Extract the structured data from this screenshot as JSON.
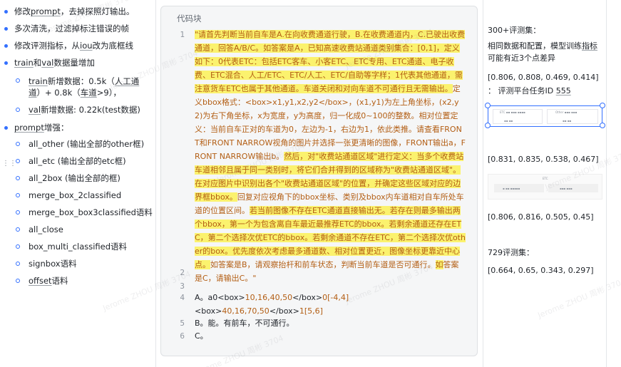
{
  "bullets": [
    {
      "text_a": "修改",
      "text_u": "prompt",
      "text_b": "，去掉探照灯输出。"
    },
    {
      "text": "多次清洗，过滤掉标注错误的帧"
    },
    {
      "text_a": "修改评测指标，从",
      "text_u": "iou",
      "text_b": "改为底框线"
    },
    {
      "text_u": "train",
      "text_a": "和",
      "text_u2": "val",
      "text_b": "数据量增加"
    }
  ],
  "sub_bullets_1": [
    {
      "text_u": "train",
      "text_a": "新增数据：0.5k（",
      "text_u2": "人工通道",
      "text_b": "）+ 0.8k（",
      "text_u3": "车道",
      "text_c": ">9），"
    },
    {
      "text_u": "val",
      "text_a": "新增数据: 0.22k(test数据)"
    }
  ],
  "bullet_prompt": {
    "text_u": "prompt",
    "text_b": "增强："
  },
  "sub_bullets_2": [
    {
      "text": "all_other (输出全部的other框)"
    },
    {
      "text": "all_etc (输出全部的etc框)"
    },
    {
      "text": "all_2box (输出全部的框)"
    },
    {
      "text": "merge_box_2classified"
    },
    {
      "text": "merge_box_box3classified语料"
    },
    {
      "text": "all_close"
    },
    {
      "text": "box_multi_classified语料"
    },
    {
      "text": "signbox语料"
    },
    {
      "text_u": "offset",
      "text_b": "语料"
    }
  ],
  "drag_icon": "⋮⋮",
  "code_block": {
    "title": "代码块",
    "line_numbers": [
      "1",
      "2",
      "3",
      "4",
      "5",
      "6"
    ],
    "line1_parts": [
      {
        "t": "\"请首先判断当前自车是A.在向收费通道行驶，B.在收费通道内，C.已驶出收费通道，回答A/B/C。如答案是A，已知高速收费站通道类别集合：[0,1]，定义如下：0代表ETC：包括ETC客车、小客ETC、ETC专用、ETC通道、电子收费、ETC混合、人工/ETC、ETC/人工、ETC/自助等字样；1代表其他通道，需注意货车ETC也属于其他通道。车道关闭和对向车道不可通行且无需输出。",
        "hl": true
      },
      {
        "t": "定义bbox格式：<box>x1,y1,x2,y2</box>，(x1,y1)为左上角坐标，(x2,y2)为右下角坐标，x为宽度，y为高度，归一化成0~100的整数。相对位置定义：当前自车正对的车道为0，左边为-1，右边为1，依此类推。请查看FRONT和FRONT NARROW视角的图片并选择一张更清晰的图像，FRONT输出a，FRONT NARROW输出b。",
        "hl": false
      },
      {
        "t": "然后，对\"收费站通道区域\"进行定义：当多个收费站车道相邻且属于同一类别时，将它们合并得到的区域称为\"收费站通道区域\"。在对应图片中识别出各个\"收费站通道区域\"的位置，并确定这些区域对应的边界框bbox。",
        "hl": true
      },
      {
        "t": "回复对应视角下的bbox坐标、类别及bbox内车道相对自车所处车道的位置区间。",
        "hl": false
      },
      {
        "t": "若当前图像不存在ETC通道直接输出无。若存在则最多输出两个bbox，第一个为包含离自车最近最推荐ETC的bbox。若剩余通道还存在ETC，第二个选择次优ETC的bbox。若剩余通道不存在ETC，第二个选择次优other的box。优先度依次考虑最多通道数、相对位置更近，图像坐标更靠近中心点。",
        "hl": true
      },
      {
        "t": "如答案是B，请观察抬杆和前车状态，判断当前车道是否可通行。",
        "hl": false
      },
      {
        "t": "如",
        "hl": true
      },
      {
        "t": "答案是C，请输出C。\"",
        "hl": false
      }
    ],
    "line4_a": "A。a0",
    "line4_b": "<box>",
    "line4_c": "10,16,40,50",
    "line4_d": "</box>",
    "line4_e": "0[-4,4]",
    "line4_f": "<box>",
    "line4_g": "40,16,70,50",
    "line4_h": "</box>",
    "line4_i": "1[5,6]",
    "line5": "B。能。有前车，不可通行。",
    "line6": "C。"
  },
  "right_panel": {
    "heading_300": "300+评测集：",
    "desc_a": "相同数据和配置，模型训练",
    "desc_u": "指标",
    "desc_b": "可能有近3个点差异",
    "score_1": "[0.806, 0.808, 0.469, 0.414]",
    "task_prefix": "：  评测平台任务ID ",
    "task_id": "555",
    "score_2": "[0.831, 0.835, 0.538, 0.467]",
    "score_3": "[0.806, 0.816, 0.505, 0.45]",
    "heading_729": "729评测集：",
    "score_4": "[0.664, 0.65, 0.343, 0.297]"
  },
  "watermark": "Jerome ZHOU 周彬 3704",
  "colors": {
    "accent": "#3370ff",
    "highlight": "#fbf26e",
    "code_text": "#b35e14"
  }
}
